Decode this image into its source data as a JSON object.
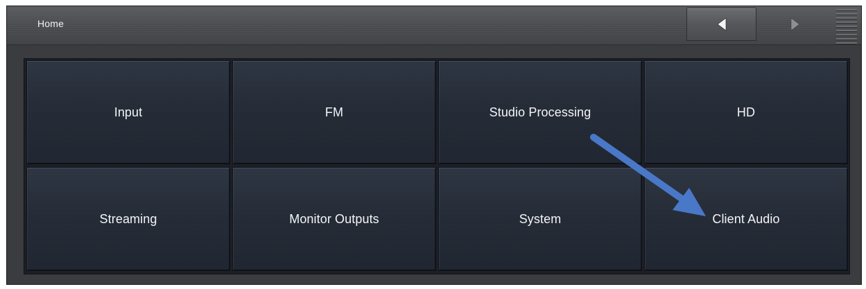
{
  "header": {
    "title": "Home",
    "back_icon": "triangle-left-icon",
    "forward_icon": "triangle-right-icon",
    "menu_icon": "menu-lines-icon"
  },
  "tiles": [
    {
      "label": "Input"
    },
    {
      "label": "FM"
    },
    {
      "label": "Studio Processing"
    },
    {
      "label": "HD"
    },
    {
      "label": "Streaming"
    },
    {
      "label": "Monitor Outputs"
    },
    {
      "label": "System"
    },
    {
      "label": "Client Audio"
    }
  ],
  "annotation": {
    "arrow_color": "#4a78c8"
  },
  "colors": {
    "tile_bg": "#242b36",
    "topbar_bg": "#4b4d50",
    "text": "#f4f5f7"
  }
}
